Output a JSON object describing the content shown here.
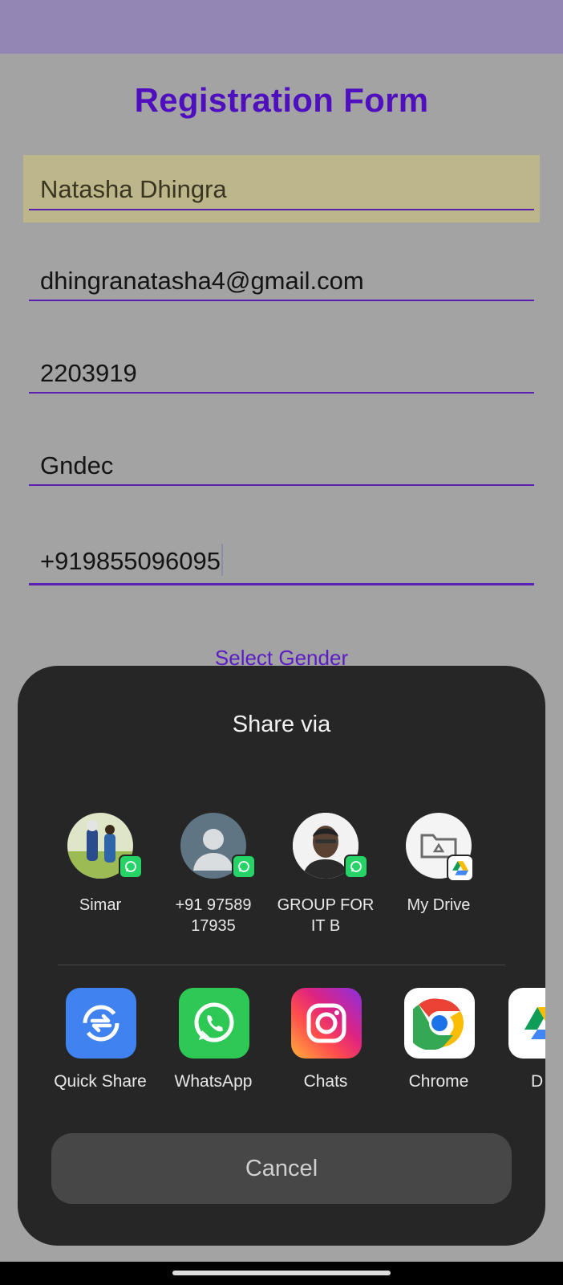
{
  "form": {
    "title": "Registration Form",
    "name_value": "Natasha Dhingra",
    "email_value": "dhingranatasha4@gmail.com",
    "roll_value": "2203919",
    "college_value": "Gndec",
    "phone_value": "+919855096095",
    "select_gender": "Select Gender"
  },
  "share": {
    "title": "Share via",
    "direct_targets": [
      {
        "label": "Simar",
        "app": "whatsapp"
      },
      {
        "label": "+91 97589 17935",
        "app": "whatsapp"
      },
      {
        "label": "GROUP FOR IT B",
        "app": "whatsapp"
      },
      {
        "label": "My Drive",
        "app": "drive"
      }
    ],
    "apps": [
      {
        "label": "Quick Share",
        "icon": "quick-share-icon"
      },
      {
        "label": "WhatsApp",
        "icon": "whatsapp-icon"
      },
      {
        "label": "Chats",
        "icon": "instagram-icon"
      },
      {
        "label": "Chrome",
        "icon": "chrome-icon"
      },
      {
        "label": "D",
        "icon": "drive-icon"
      }
    ],
    "cancel_label": "Cancel"
  },
  "colors": {
    "accent": "#4f0fbf",
    "appbar": "#9486b4",
    "sheet": "#262626"
  }
}
